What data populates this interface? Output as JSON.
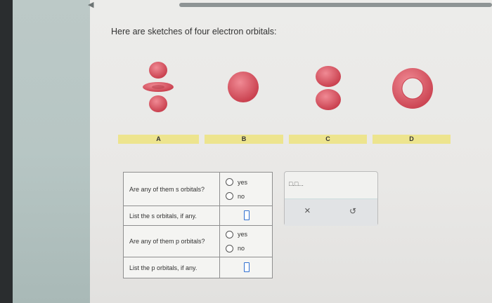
{
  "prompt": "Here are sketches of four electron orbitals:",
  "orbital_labels": [
    "A",
    "B",
    "C",
    "D"
  ],
  "questions": [
    {
      "text": "Are any of them s orbitals?",
      "options": [
        "yes",
        "no"
      ]
    },
    {
      "text": "List the s orbitals, if any."
    },
    {
      "text": "Are any of them p orbitals?",
      "options": [
        "yes",
        "no"
      ]
    },
    {
      "text": "List the p orbitals, if any."
    }
  ],
  "tools": {
    "subscript_label": "□.□...",
    "clear_label": "×",
    "undo_label": "↺"
  },
  "colors": {
    "orbital": "#d9505c",
    "label_bar": "#ede48e",
    "input_border": "#2f6fd0"
  }
}
